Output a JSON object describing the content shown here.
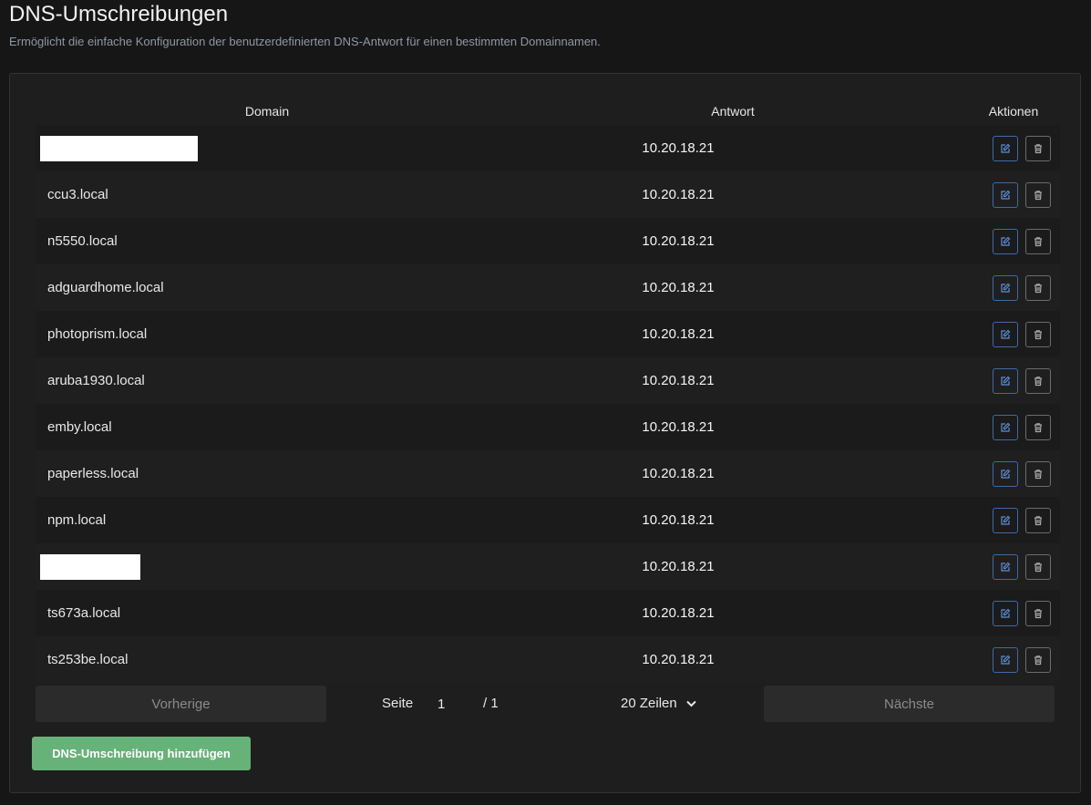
{
  "header": {
    "title": "DNS-Umschreibungen",
    "subtitle": "Ermöglicht die einfache Konfiguration der benutzerdefinierten DNS-Antwort für einen bestimmten Domainnamen."
  },
  "table": {
    "columns": [
      "Domain",
      "Antwort",
      "Aktionen"
    ],
    "rows": [
      {
        "domain": "",
        "answer": "10.20.18.21",
        "redacted": true
      },
      {
        "domain": "ccu3.local",
        "answer": "10.20.18.21"
      },
      {
        "domain": "n5550.local",
        "answer": "10.20.18.21"
      },
      {
        "domain": "adguardhome.local",
        "answer": "10.20.18.21"
      },
      {
        "domain": "photoprism.local",
        "answer": "10.20.18.21"
      },
      {
        "domain": "aruba1930.local",
        "answer": "10.20.18.21"
      },
      {
        "domain": "emby.local",
        "answer": "10.20.18.21"
      },
      {
        "domain": "paperless.local",
        "answer": "10.20.18.21"
      },
      {
        "domain": "npm.local",
        "answer": "10.20.18.21"
      },
      {
        "domain": "",
        "answer": "10.20.18.21",
        "redacted": true
      },
      {
        "domain": "ts673a.local",
        "answer": "10.20.18.21"
      },
      {
        "domain": "ts253be.local",
        "answer": "10.20.18.21"
      }
    ],
    "actions": {
      "edit_icon": "edit-icon",
      "delete_icon": "trash-icon"
    }
  },
  "pagination": {
    "prev_label": "Vorherige",
    "next_label": "Nächste",
    "page_label": "Seite",
    "current_page": "1",
    "total_pages": "/ 1",
    "rows_per_page": "20 Zeilen"
  },
  "add_button_label": "DNS-Umschreibung hinzufügen",
  "colors": {
    "accent_green": "#67b279",
    "edit_blue": "#3d6aa8",
    "background": "#161616",
    "card": "#1e1e1e"
  }
}
